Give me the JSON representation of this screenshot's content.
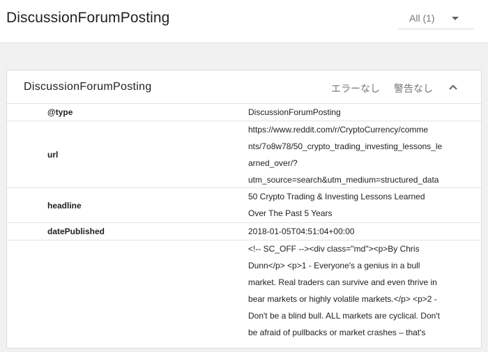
{
  "header": {
    "title": "DiscussionForumPosting",
    "filter": {
      "selected": "All (1)"
    }
  },
  "card": {
    "title": "DiscussionForumPosting",
    "errors_label": "エラーなし",
    "warnings_label": "警告なし",
    "collapse_icon": "chevron-up-icon",
    "rows": [
      {
        "name": "@type",
        "value": "DiscussionForumPosting"
      },
      {
        "name": "url",
        "value_lines": [
          "https://www.reddit.com/r/CryptoCurrency/comme",
          "nts/7o8w78/50_crypto_trading_investing_lessons_le",
          "arned_over/?",
          "utm_source=search&utm_medium=structured_data"
        ]
      },
      {
        "name": "headline",
        "value_lines": [
          "50 Crypto Trading & Investing Lessons Learned",
          "Over The Past 5 Years"
        ]
      },
      {
        "name": "datePublished",
        "value": "2018-01-05T04:51:04+00:00"
      },
      {
        "name": "",
        "value_lines": [
          "<!-- SC_OFF --><div class=\"md\"><p>By Chris",
          "Dunn</p> <p>1 - Everyone's a genius in a bull",
          "market. Real traders can survive and even thrive in",
          "bear markets or highly volatile markets.</p> <p>2 -",
          "Don't be a blind bull. ALL markets are cyclical. Don't",
          "be afraid of pullbacks or market crashes – that's"
        ]
      }
    ]
  }
}
